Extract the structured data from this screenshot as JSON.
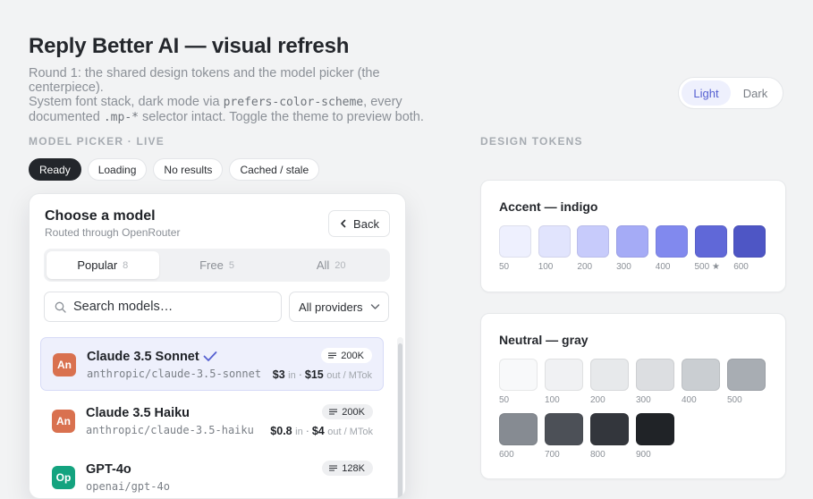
{
  "header": {
    "title": "Reply Better AI — visual refresh",
    "subtitle_1": "Round 1: the shared design tokens and the model picker (the centerpiece).",
    "subtitle_2": "System font stack, dark mode via ",
    "subtitle_code_1": "prefers-color-scheme",
    "subtitle_3": ", every",
    "subtitle_4": "documented ",
    "subtitle_code_2": ".mp-*",
    "subtitle_5": " selector intact. Toggle the theme to preview both."
  },
  "theme_toggle": {
    "light": "Light",
    "dark": "Dark",
    "active": "Light"
  },
  "model_picker_section": {
    "label": "MODEL PICKER · LIVE",
    "states": [
      "Ready",
      "Loading",
      "No results",
      "Cached / stale"
    ],
    "active_state": "Ready"
  },
  "picker": {
    "title": "Choose a model",
    "subtitle": "Routed through OpenRouter",
    "back_label": "Back",
    "tabs": [
      {
        "label": "Popular",
        "count": "8"
      },
      {
        "label": "Free",
        "count": "5"
      },
      {
        "label": "All",
        "count": "20"
      }
    ],
    "active_tab": "Popular",
    "search_placeholder": "Search models…",
    "provider_filter": "All providers",
    "models": [
      {
        "initials": "An",
        "color": "#d9714f",
        "name": "Claude 3.5 Sonnet",
        "id": "anthropic/claude-3.5-sonnet",
        "context": "200K",
        "price_in": "$3",
        "price_out": "$15",
        "in_label": "in",
        "out_label": "out / MTok",
        "selected": true
      },
      {
        "initials": "An",
        "color": "#d9714f",
        "name": "Claude 3.5 Haiku",
        "id": "anthropic/claude-3.5-haiku",
        "context": "200K",
        "price_in": "$0.8",
        "price_out": "$4",
        "in_label": "in",
        "out_label": "out / MTok",
        "selected": false
      },
      {
        "initials": "Op",
        "color": "#14a37f",
        "name": "GPT-4o",
        "id": "openai/gpt-4o",
        "context": "128K",
        "selected": false
      }
    ]
  },
  "design_tokens_section": {
    "label": "DESIGN TOKENS",
    "accent": {
      "title": "Accent — indigo",
      "swatches": [
        {
          "label": "50",
          "color": "#eef0fe"
        },
        {
          "label": "100",
          "color": "#e1e4fd"
        },
        {
          "label": "200",
          "color": "#c7cbfb"
        },
        {
          "label": "300",
          "color": "#a5abf6"
        },
        {
          "label": "400",
          "color": "#8189ee"
        },
        {
          "label": "500 ★",
          "color": "#6068d8"
        },
        {
          "label": "600",
          "color": "#4e56c5"
        }
      ]
    },
    "neutral": {
      "title": "Neutral — gray",
      "swatches": [
        {
          "label": "50",
          "color": "#f8f9fa"
        },
        {
          "label": "100",
          "color": "#f0f1f3"
        },
        {
          "label": "200",
          "color": "#e7e9eb"
        },
        {
          "label": "300",
          "color": "#dcdee1"
        },
        {
          "label": "400",
          "color": "#caced2"
        },
        {
          "label": "500",
          "color": "#a8adb3"
        },
        {
          "label": "600",
          "color": "#868b92"
        },
        {
          "label": "700",
          "color": "#4c5057"
        },
        {
          "label": "800",
          "color": "#33363c"
        },
        {
          "label": "900",
          "color": "#202327"
        }
      ]
    }
  }
}
